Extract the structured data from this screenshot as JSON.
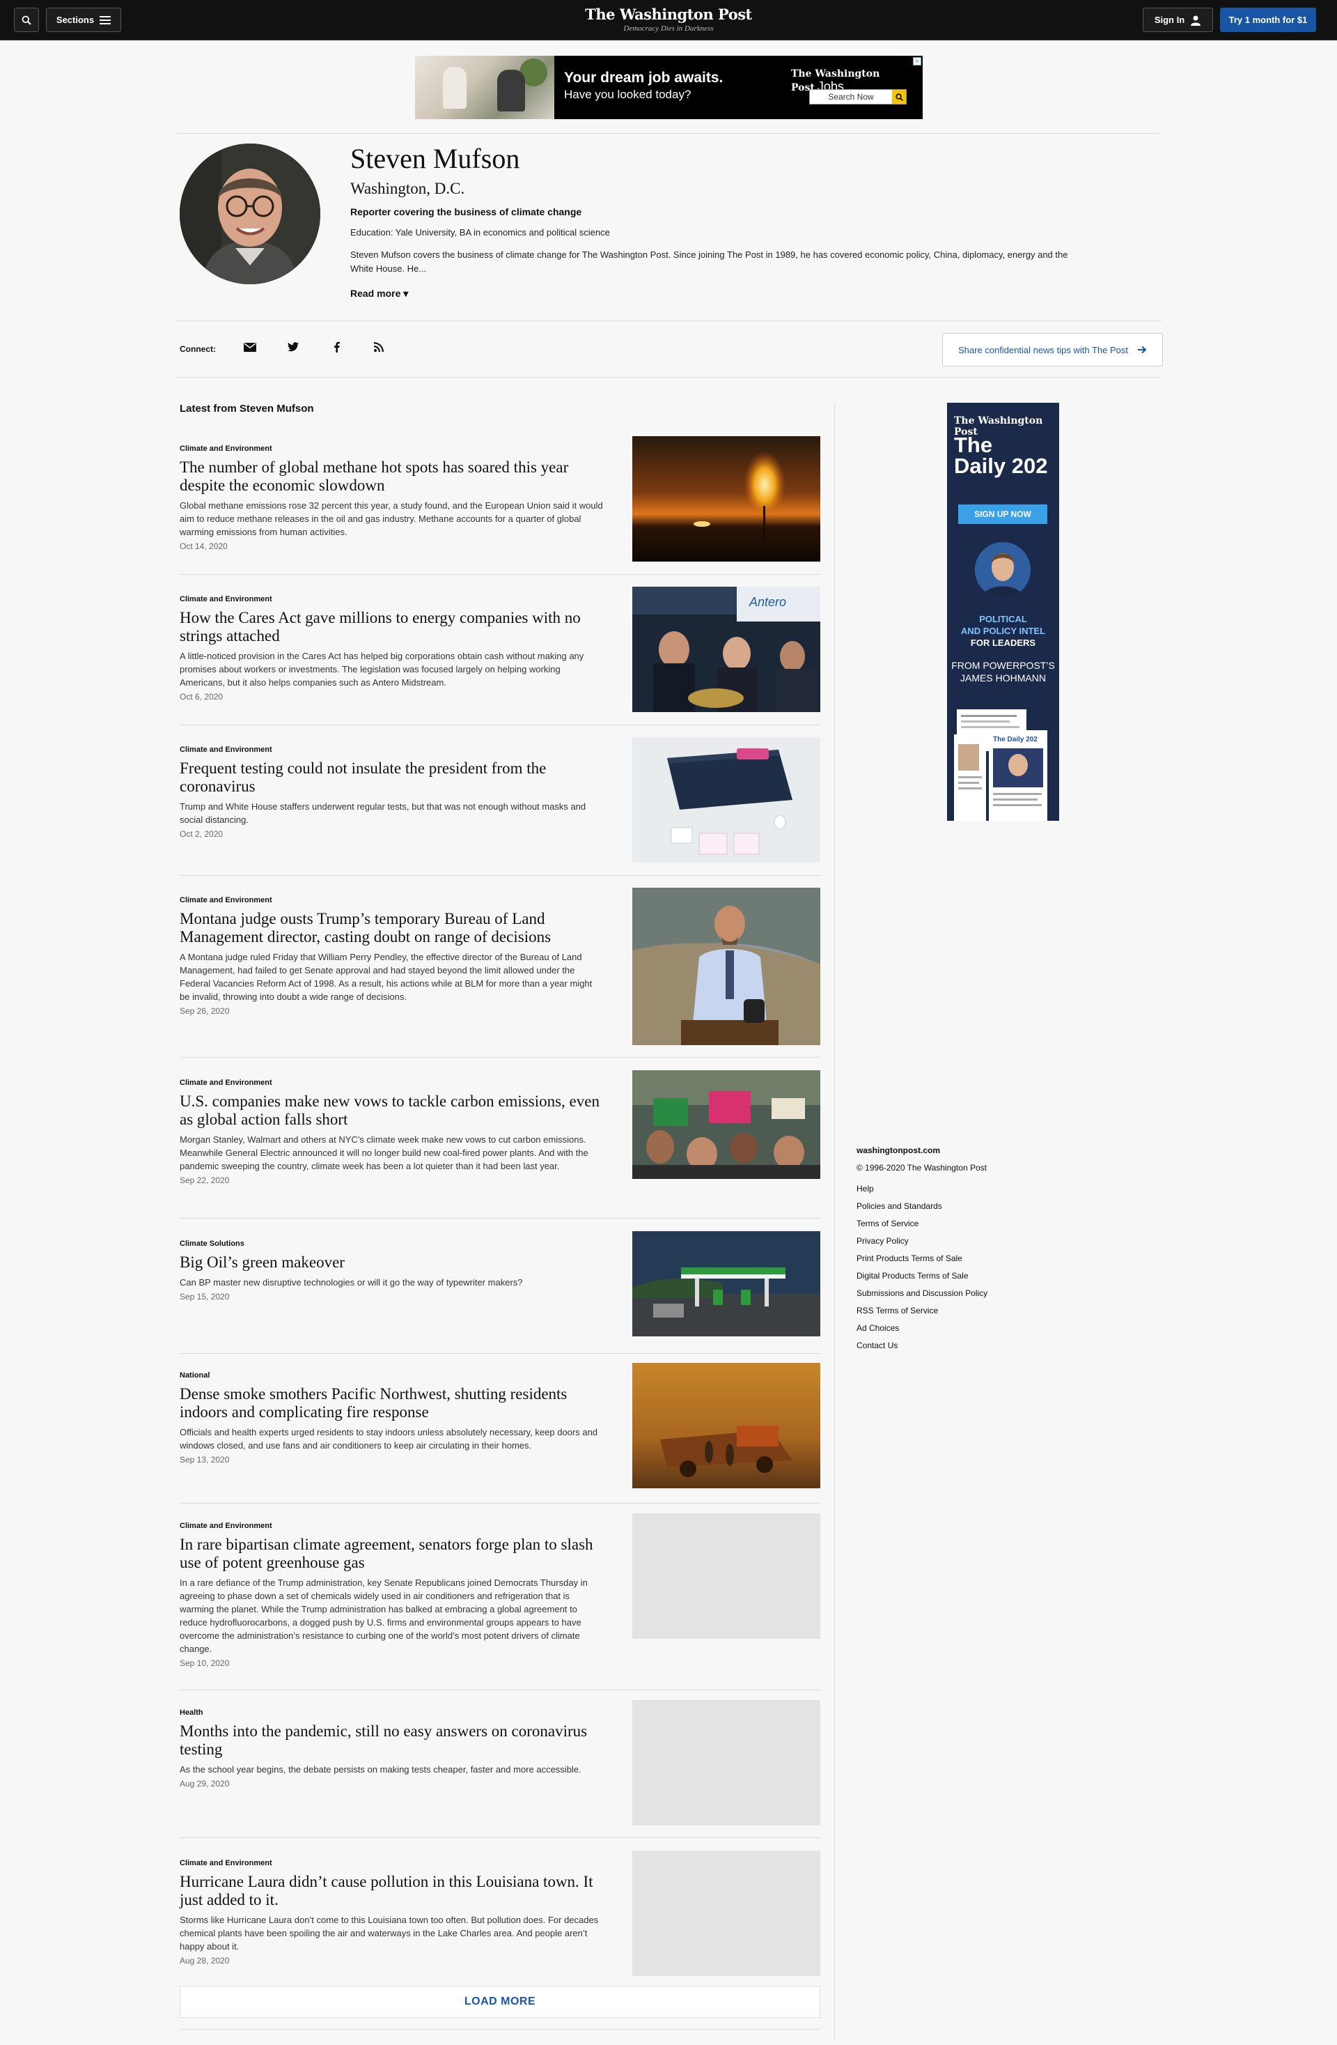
{
  "header": {
    "sections_label": "Sections",
    "logo_name": "The Washington Post",
    "logo_tagline": "Democracy Dies in Darkness",
    "signin_label": "Sign In",
    "trial_label": "Try 1 month for $1"
  },
  "ad_banner": {
    "headline": "Your dream job awaits.",
    "subline": "Have you looked today?",
    "brand": "The Washington Post",
    "brand_product": "Jobs",
    "search_label": "Search Now"
  },
  "profile": {
    "name": "Steven Mufson",
    "location": "Washington, D.C.",
    "role": "Reporter covering the business of climate change",
    "education": "Education: Yale University, BA in economics and political science",
    "bio": "Steven Mufson covers the business of climate change for The Washington Post. Since joining The Post in 1989, he has covered economic policy, China, diplomacy, energy and the White House. He...",
    "read_more": "Read more"
  },
  "connect": {
    "label": "Connect:",
    "icons": [
      "email-icon",
      "twitter-icon",
      "facebook-icon",
      "rss-icon"
    ],
    "tips_button": "Share confidential news tips with The Post"
  },
  "latest_heading": "Latest from Steven Mufson",
  "articles": [
    {
      "category": "Climate and Environment",
      "title": "The number of global methane hot spots has soared this year despite the economic slowdown",
      "description": "Global methane emissions rose 32 percent this year, a study found, and the European Union said it would aim to reduce methane releases in the oil and gas industry. Methane accounts for a quarter of global warming emissions from human activities.",
      "date": "Oct 14, 2020"
    },
    {
      "category": "Climate and Environment",
      "title": "How the Cares Act gave millions to energy companies with no strings attached",
      "description": "A little-noticed provision in the Cares Act has helped big corporations obtain cash without making any promises about workers or investments. The legislation was focused largely on helping working Americans, but it also helps companies such as Antero Midstream.",
      "date": "Oct 6, 2020"
    },
    {
      "category": "Climate and Environment",
      "title": "Frequent testing could not insulate the president from the coronavirus",
      "description": "Trump and White House staffers underwent regular tests, but that was not enough without masks and social distancing.",
      "date": "Oct 2, 2020"
    },
    {
      "category": "Climate and Environment",
      "title": "Montana judge ousts Trump’s temporary Bureau of Land Management director, casting doubt on range of decisions",
      "description": "A Montana judge ruled Friday that William Perry Pendley, the effective director of the Bureau of Land Management, had failed to get Senate approval and had stayed beyond the limit allowed under the Federal Vacancies Reform Act of 1998. As a result, his actions while at BLM for more than a year might be invalid, throwing into doubt a wide range of decisions.",
      "date": "Sep 26, 2020"
    },
    {
      "category": "Climate and Environment",
      "title": "U.S. companies make new vows to tackle carbon emissions, even as global action falls short",
      "description": "Morgan Stanley, Walmart and others at NYC’s climate week make new vows to cut carbon emissions. Meanwhile General Electric announced it will no longer build new coal-fired power plants. And with the pandemic sweeping the country, climate week has been a lot quieter than it had been last year.",
      "date": "Sep 22, 2020"
    },
    {
      "category": "Climate Solutions",
      "title": "Big Oil’s green makeover",
      "description": "Can BP master new disruptive technologies or will it go the way of typewriter makers?",
      "date": "Sep 15, 2020"
    },
    {
      "category": "National",
      "title": "Dense smoke smothers Pacific Northwest, shutting residents indoors and complicating fire response",
      "description": "Officials and health experts urged residents to stay indoors unless absolutely necessary, keep doors and windows closed, and use fans and air conditioners to keep air circulating in their homes.",
      "date": "Sep 13, 2020"
    },
    {
      "category": "Climate and Environment",
      "title": "In rare bipartisan climate agreement, senators forge plan to slash use of potent greenhouse gas",
      "description": "In a rare defiance of the Trump administration, key Senate Republicans joined Democrats Thursday in agreeing to phase down a set of chemicals widely used in air conditioners and refrigeration that is warming the planet. While the Trump administration has balked at embracing a global agreement to reduce hydrofluorocarbons, a dogged push by U.S. firms and environmental groups appears to have overcome the administration’s resistance to curbing one of the world’s most potent drivers of climate change.",
      "date": "Sep 10, 2020"
    },
    {
      "category": "Health",
      "title": "Months into the pandemic, still no easy answers on coronavirus testing",
      "description": "As the school year begins, the debate persists on making tests cheaper, faster and more accessible.",
      "date": "Aug 29, 2020"
    },
    {
      "category": "Climate and Environment",
      "title": "Hurricane Laura didn’t cause pollution in this Louisiana town. It just added to it.",
      "description": "Storms like Hurricane Laura don’t come to this Louisiana town too often. But pollution does. For decades chemical plants have been spoiling the air and waterways in the Lake Charles area. And people aren’t happy about it.",
      "date": "Aug 28, 2020"
    }
  ],
  "load_more": "LOAD MORE",
  "sidebar_ad": {
    "logo": "The Washington Post",
    "title_line1": "The",
    "title_line2": "Daily 202",
    "button": "SIGN UP NOW",
    "intel_line1": "POLITICAL",
    "intel_line2": "AND POLICY INTEL",
    "intel_line3": "FOR LEADERS",
    "from_line1": "FROM POWERPOST’S",
    "from_line2": "JAMES HOHMANN"
  },
  "footer": {
    "site": "washingtonpost.com",
    "copyright": "© 1996-2020 The Washington Post",
    "links": [
      "Help",
      "Policies and Standards",
      "Terms of Service",
      "Privacy Policy",
      "Print Products Terms of Sale",
      "Digital Products Terms of Sale",
      "Submissions and Discussion Policy",
      "RSS Terms of Service",
      "Ad Choices",
      "Contact Us"
    ]
  },
  "colors": {
    "accent": "#1955a5",
    "topbar": "#111111",
    "page_bg": "#f7f7f7"
  }
}
